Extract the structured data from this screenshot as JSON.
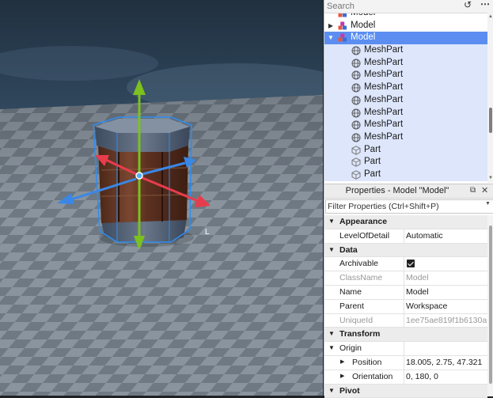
{
  "viewport": {
    "cursor_label": "L"
  },
  "explorer": {
    "search_placeholder": "Search",
    "history_icon": "history-icon",
    "more_icon": "more-icon",
    "tree": [
      {
        "label": "Model",
        "type": "model",
        "depth": 0,
        "arrow": "",
        "state": "normal"
      },
      {
        "label": "Model",
        "type": "model",
        "depth": 0,
        "arrow": "▶",
        "state": "normal"
      },
      {
        "label": "Model",
        "type": "model",
        "depth": 0,
        "arrow": "▼",
        "state": "selected-primary"
      },
      {
        "label": "MeshPart",
        "type": "meshpart",
        "depth": 1,
        "arrow": "",
        "state": "selected"
      },
      {
        "label": "MeshPart",
        "type": "meshpart",
        "depth": 1,
        "arrow": "",
        "state": "selected"
      },
      {
        "label": "MeshPart",
        "type": "meshpart",
        "depth": 1,
        "arrow": "",
        "state": "selected"
      },
      {
        "label": "MeshPart",
        "type": "meshpart",
        "depth": 1,
        "arrow": "",
        "state": "selected"
      },
      {
        "label": "MeshPart",
        "type": "meshpart",
        "depth": 1,
        "arrow": "",
        "state": "selected"
      },
      {
        "label": "MeshPart",
        "type": "meshpart",
        "depth": 1,
        "arrow": "",
        "state": "selected"
      },
      {
        "label": "MeshPart",
        "type": "meshpart",
        "depth": 1,
        "arrow": "",
        "state": "selected"
      },
      {
        "label": "MeshPart",
        "type": "meshpart",
        "depth": 1,
        "arrow": "",
        "state": "selected"
      },
      {
        "label": "Part",
        "type": "part",
        "depth": 1,
        "arrow": "",
        "state": "selected"
      },
      {
        "label": "Part",
        "type": "part",
        "depth": 1,
        "arrow": "",
        "state": "selected"
      },
      {
        "label": "Part",
        "type": "part",
        "depth": 1,
        "arrow": "",
        "state": "selected"
      }
    ]
  },
  "properties": {
    "title": "Properties - Model \"Model\"",
    "filter_placeholder": "Filter Properties (Ctrl+Shift+P)",
    "rows": [
      {
        "kind": "section",
        "name": "Appearance"
      },
      {
        "kind": "prop",
        "name": "LevelOfDetail",
        "value": "Automatic"
      },
      {
        "kind": "section",
        "name": "Data"
      },
      {
        "kind": "check",
        "name": "Archivable",
        "checked": true
      },
      {
        "kind": "prop",
        "name": "ClassName",
        "value": "Model",
        "dim": true
      },
      {
        "kind": "prop",
        "name": "Name",
        "value": "Model"
      },
      {
        "kind": "prop",
        "name": "Parent",
        "value": "Workspace"
      },
      {
        "kind": "prop",
        "name": "UniqueId",
        "value": "1ee75ae819f1b6130a...",
        "dim": true
      },
      {
        "kind": "section",
        "name": "Transform"
      },
      {
        "kind": "group",
        "name": "Origin",
        "value": ""
      },
      {
        "kind": "sub",
        "name": "Position",
        "value": "18.005, 2.75, 47.321"
      },
      {
        "kind": "sub",
        "name": "Orientation",
        "value": "0, 180, 0"
      },
      {
        "kind": "section",
        "name": "Pivot"
      }
    ]
  },
  "colors": {
    "selection_primary": "#5b8ef0",
    "selection_secondary": "#dde6fb",
    "gizmo_y": "#7cc11e",
    "gizmo_x": "#e83c4c",
    "gizmo_z": "#3a87e6",
    "selection_box": "#2f8df0"
  }
}
